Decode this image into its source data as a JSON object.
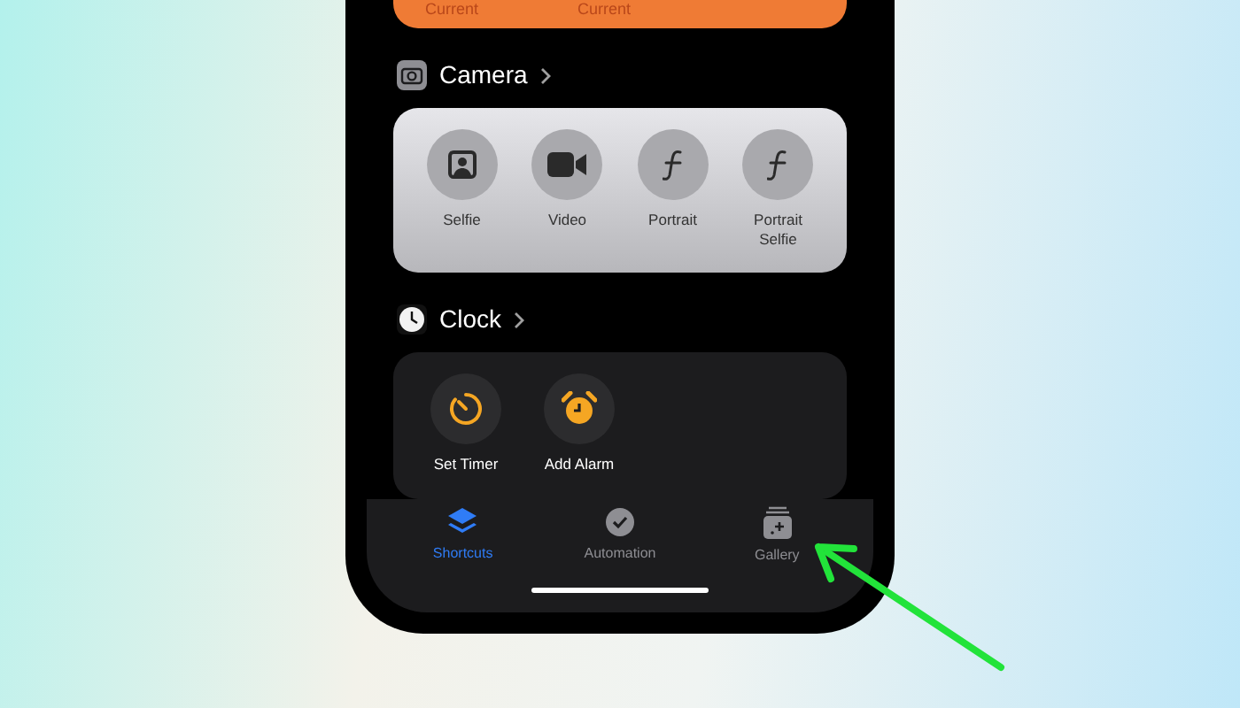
{
  "top_card": {
    "labels": [
      "Current",
      "Current"
    ]
  },
  "sections": [
    {
      "title": "Camera",
      "kind": "camera",
      "actions": [
        {
          "label": "Selfie",
          "kind": "portrait"
        },
        {
          "label": "Video",
          "kind": "video"
        },
        {
          "label": "Portrait",
          "kind": "aperture"
        },
        {
          "label": "Portrait Selfie",
          "kind": "aperture"
        }
      ]
    },
    {
      "title": "Clock",
      "kind": "clock",
      "actions": [
        {
          "label": "Set Timer",
          "kind": "timer"
        },
        {
          "label": "Add Alarm",
          "kind": "alarm"
        }
      ]
    }
  ],
  "tab_bar": [
    {
      "label": "Shortcuts",
      "kind": "layers",
      "selected": true
    },
    {
      "label": "Automation",
      "kind": "automation",
      "selected": false
    },
    {
      "label": "Gallery",
      "kind": "gallery",
      "selected": false
    }
  ]
}
